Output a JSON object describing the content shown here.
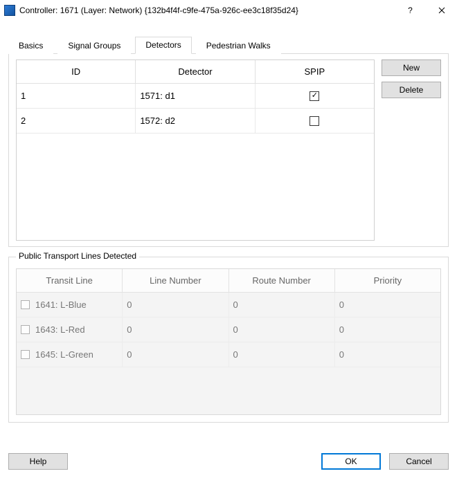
{
  "window": {
    "title": "Controller: 1671 (Layer: Network) {132b4f4f-c9fe-475a-926c-ee3c18f35d24}"
  },
  "tabs": {
    "basics": "Basics",
    "signal_groups": "Signal Groups",
    "detectors": "Detectors",
    "pedestrian_walks": "Pedestrian Walks"
  },
  "detectors_table": {
    "headers": {
      "id": "ID",
      "detector": "Detector",
      "spip": "SPIP"
    },
    "rows": [
      {
        "id": "1",
        "detector": "1571: d1",
        "spip": true
      },
      {
        "id": "2",
        "detector": "1572: d2",
        "spip": false
      }
    ]
  },
  "side_buttons": {
    "new": "New",
    "delete": "Delete"
  },
  "pt_group": {
    "legend": "Public Transport Lines Detected",
    "headers": {
      "line": "Transit Line",
      "number": "Line Number",
      "route": "Route Number",
      "priority": "Priority"
    },
    "rows": [
      {
        "checked": false,
        "line": "1641: L-Blue",
        "number": "0",
        "route": "0",
        "priority": "0"
      },
      {
        "checked": false,
        "line": "1643: L-Red",
        "number": "0",
        "route": "0",
        "priority": "0"
      },
      {
        "checked": false,
        "line": "1645: L-Green",
        "number": "0",
        "route": "0",
        "priority": "0"
      }
    ]
  },
  "bottom": {
    "help": "Help",
    "ok": "OK",
    "cancel": "Cancel"
  }
}
